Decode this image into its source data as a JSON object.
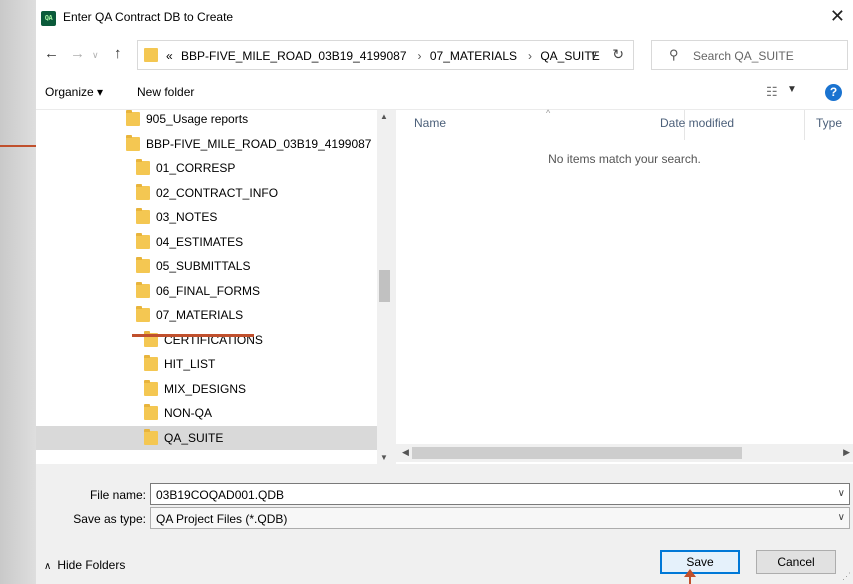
{
  "window": {
    "title": "Enter QA Contract DB to Create",
    "app_icon_text": "QA"
  },
  "nav": {
    "breadcrumb_overflow": "«",
    "breadcrumbs": [
      "BBP-FIVE_MILE_ROAD_03B19_4199087",
      "07_MATERIALS",
      "QA_SUITE"
    ],
    "search_placeholder": "Search QA_SUITE"
  },
  "toolbar": {
    "organize_label": "Organize ▾",
    "new_folder_label": "New folder"
  },
  "tree": {
    "items": [
      {
        "label": "905_Usage reports",
        "indent": 0
      },
      {
        "label": "BBP-FIVE_MILE_ROAD_03B19_4199087",
        "indent": 0
      },
      {
        "label": "01_CORRESP",
        "indent": 1
      },
      {
        "label": "02_CONTRACT_INFO",
        "indent": 1
      },
      {
        "label": "03_NOTES",
        "indent": 1
      },
      {
        "label": "04_ESTIMATES",
        "indent": 1
      },
      {
        "label": "05_SUBMITTALS",
        "indent": 1
      },
      {
        "label": "06_FINAL_FORMS",
        "indent": 1
      },
      {
        "label": "07_MATERIALS",
        "indent": 1
      },
      {
        "label": "CERTIFICATIONS",
        "indent": 2
      },
      {
        "label": "HIT_LIST",
        "indent": 2
      },
      {
        "label": "MIX_DESIGNS",
        "indent": 2
      },
      {
        "label": "NON-QA",
        "indent": 2
      },
      {
        "label": "QA_SUITE",
        "indent": 2,
        "selected": true
      }
    ]
  },
  "files": {
    "columns": [
      "Name",
      "Date modified",
      "Type"
    ],
    "empty_message": "No items match your search."
  },
  "form": {
    "file_name_label": "File name:",
    "file_name_value": "03B19COQAD001.QDB",
    "save_type_label": "Save as type:",
    "save_type_value": "QA Project Files (*.QDB)"
  },
  "footer": {
    "hide_folders_label": "Hide Folders",
    "save_label": "Save",
    "cancel_label": "Cancel"
  },
  "colors": {
    "annotation": "#c0502d",
    "folder": "#f4c752",
    "accent": "#0078d7"
  }
}
